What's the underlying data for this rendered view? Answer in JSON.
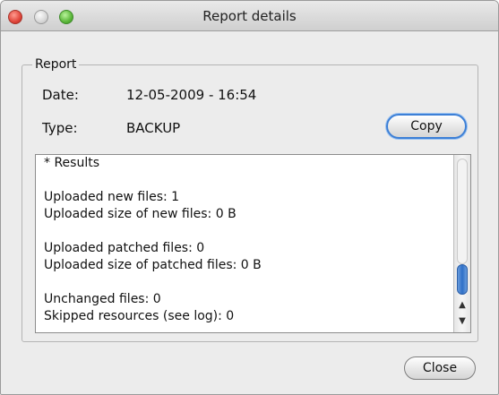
{
  "window": {
    "title": "Report details"
  },
  "report": {
    "group_title": "Report",
    "date_label": "Date:",
    "date_value": "12-05-2009 - 16:54",
    "type_label": "Type:",
    "type_value": "BACKUP",
    "copy_label": "Copy",
    "results": {
      "header": "* Results",
      "lines": [
        "Uploaded new files: 1",
        "Uploaded size of new files: 0 B",
        "Uploaded patched files: 0",
        "Uploaded size of patched files: 0 B",
        "Unchanged files: 0",
        "Skipped resources (see log): 0"
      ]
    }
  },
  "footer": {
    "close_label": "Close"
  },
  "icons": {
    "window_close": "close-traffic-light-icon",
    "window_minimize": "minimize-traffic-light-icon",
    "window_zoom": "zoom-traffic-light-icon",
    "scroll_up": "arrow-up-icon",
    "scroll_down": "arrow-down-icon"
  },
  "colors": {
    "window_bg": "#ececec",
    "copy_focus_ring": "#3c7fd6",
    "scroll_thumb": "#2e6fc7"
  }
}
